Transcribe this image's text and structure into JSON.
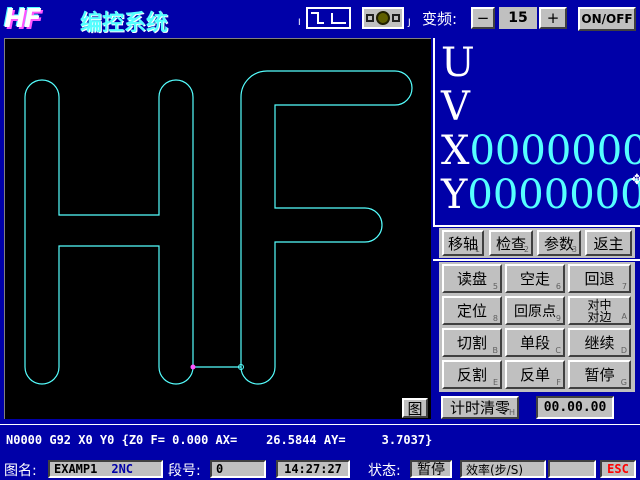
{
  "header": {
    "logo": "HF",
    "title": "编控系统",
    "pulse_left_label": "I",
    "pulse_right_label": "J",
    "freq_label": "变频:",
    "freq_minus": "−",
    "freq_value": "15",
    "freq_plus": "+",
    "onoff_label": "ON/OFF"
  },
  "coords": {
    "u_axis": "U",
    "u_value": "",
    "v_axis": "V",
    "v_value": "",
    "x_axis": "X",
    "x_value": "0000000",
    "y_axis": "Y",
    "y_value": "0000000"
  },
  "nav_buttons": [
    {
      "label": "移轴",
      "hotkey": "1"
    },
    {
      "label": "检查",
      "hotkey": "2"
    },
    {
      "label": "参数",
      "hotkey": "3"
    },
    {
      "label": "返主",
      "hotkey": ""
    }
  ],
  "func_buttons": [
    {
      "label": "读盘",
      "hotkey": "5"
    },
    {
      "label": "空走",
      "hotkey": "6"
    },
    {
      "label": "回退",
      "hotkey": "7"
    },
    {
      "label": "定位",
      "hotkey": "8"
    },
    {
      "label": "回原点",
      "hotkey": "9"
    },
    {
      "label": "对中\n对边",
      "hotkey": "A"
    },
    {
      "label": "切割",
      "hotkey": "B"
    },
    {
      "label": "单段",
      "hotkey": "C"
    },
    {
      "label": "继续",
      "hotkey": "D"
    },
    {
      "label": "反割",
      "hotkey": "E"
    },
    {
      "label": "反单",
      "hotkey": "F"
    },
    {
      "label": "暂停",
      "hotkey": "G"
    }
  ],
  "canvas": {
    "graph_button": "图"
  },
  "timer": {
    "reset_label": "计时清零",
    "reset_hotkey": "H",
    "elapsed": "00.00.00"
  },
  "gcode_line": "N0000 G92 X0 Y0 {Z0 F= 0.000 AX=    26.5844 AY=     3.7037}",
  "statusbar": {
    "file_label": "图名:",
    "file_name": "EXAMP1",
    "file_type": "2NC",
    "segment_label": "段号:",
    "segment_value": "0",
    "time": "14:27:27",
    "state_label": "状态:",
    "state_value": "暂停",
    "efficiency_label": "效率(步/S)",
    "efficiency_value": "",
    "esc_label": "ESC"
  },
  "colors": {
    "background": "#0000a8",
    "path": "#55ffff",
    "accent": "#ff0000"
  }
}
